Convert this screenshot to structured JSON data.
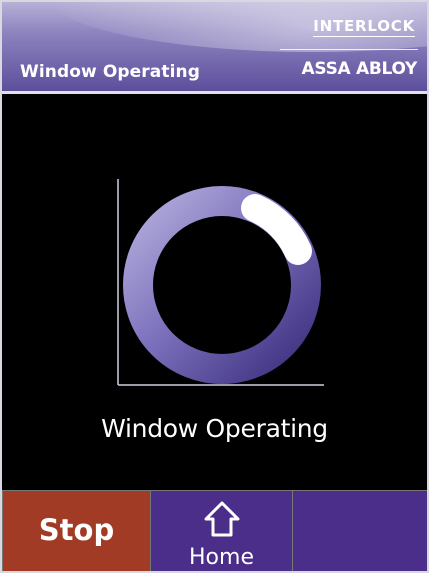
{
  "header": {
    "title": "Window Operating",
    "brand_primary": "INTERLOCK",
    "brand_secondary": "ASSA ABLOY"
  },
  "main": {
    "status_text": "Window Operating",
    "spinner_icon": "progress-ring-icon"
  },
  "buttons": {
    "stop_label": "Stop",
    "home_label": "Home",
    "home_icon": "home-icon"
  },
  "colors": {
    "header": "#7b6fb3",
    "stop": "#a23b25",
    "nav": "#4b2d8a",
    "ring": "#4a3f8c"
  }
}
